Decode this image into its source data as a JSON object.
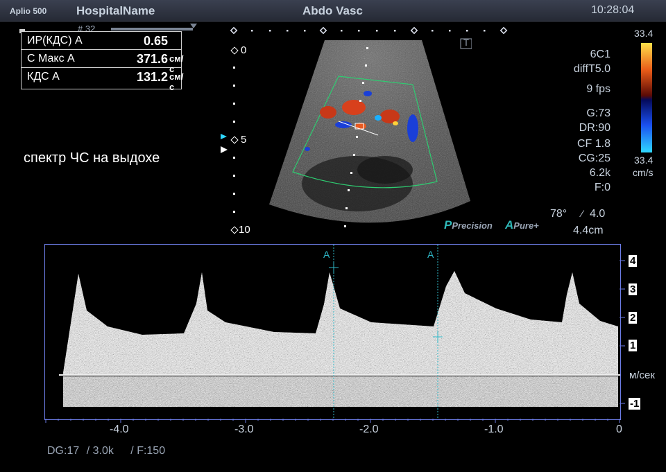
{
  "header": {
    "model": "Aplio 500",
    "hospital": "HospitalName",
    "preset": "Abdo Vasc",
    "time": "10:28:04"
  },
  "frame": {
    "number": "# 32"
  },
  "measurements": [
    {
      "label": "ИР(КДС) А",
      "value": "0.65",
      "unit": ""
    },
    {
      "label": "С Макс А",
      "value": "371.6",
      "unit": "см/с"
    },
    {
      "label": "КДС А",
      "value": "131.2",
      "unit": "см/с"
    }
  ],
  "caption": "спектр ЧС на выдохе",
  "depth_scale": {
    "top": "0",
    "mid": "5",
    "bottom": "10"
  },
  "logo": "T",
  "params": {
    "probe": "6C1",
    "mode": "diffT5.0",
    "fps": "9 fps",
    "gain": "G:73",
    "dr": "DR:90",
    "cf": "CF 1.8",
    "cg": "CG:25",
    "prf": "6.2k",
    "filter": "F:0",
    "angle": "78°",
    "angle_corr": "4.0",
    "depth": "4.4cm"
  },
  "branding": {
    "precision": "Precision",
    "pure": "Pure+"
  },
  "colorbar": {
    "max": "33.4",
    "min": "33.4",
    "unit": "cm/s",
    "top_color": "#ffe04a",
    "bottom_color": "#2fd8ff"
  },
  "doppler": {
    "velocity_ticks": [
      "4",
      "3",
      "2",
      "1",
      "-1"
    ],
    "velocity_unit": "м/сек",
    "time_ticks": [
      "-4.0",
      "-3.0",
      "-2.0",
      "-1.0",
      "0"
    ],
    "markers": [
      "A",
      "A"
    ],
    "grid_color": "#6d7de8"
  },
  "footer": {
    "dg": "DG:17",
    "prf": "/ 3.0k",
    "filter": "/ F:150"
  }
}
